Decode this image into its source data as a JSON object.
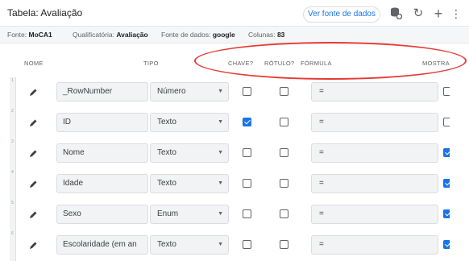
{
  "header": {
    "title": "Tabela: Avaliação",
    "view_source_label": "Ver fonte de dados",
    "icons": [
      "database-settings-icon",
      "refresh-icon",
      "add-icon",
      "more-vert-icon"
    ]
  },
  "info": {
    "source_label": "Fonte:",
    "source_value": "MoCA1",
    "qualifier_label": "Qualificatória:",
    "qualifier_value": "Avaliação",
    "datasource_label": "Fonte de dados:",
    "datasource_value": "google",
    "columns_label": "Colunas:",
    "columns_value": "83"
  },
  "columns": {
    "nome": "NOME",
    "tipo": "TIPO",
    "chave": "CHAVE?",
    "rotulo": "RÓTULO?",
    "formula": "FÓRMULA",
    "mostra": "MOSTRA"
  },
  "rows": [
    {
      "num": "1",
      "name": "_RowNumber",
      "type": "Número",
      "key": false,
      "label": false,
      "formula": "=",
      "show": false
    },
    {
      "num": "2",
      "name": "ID",
      "type": "Texto",
      "key": true,
      "label": false,
      "formula": "=",
      "show": false
    },
    {
      "num": "3",
      "name": "Nome",
      "type": "Texto",
      "key": false,
      "label": false,
      "formula": "=",
      "show": true
    },
    {
      "num": "4",
      "name": "Idade",
      "type": "Texto",
      "key": false,
      "label": false,
      "formula": "=",
      "show": true
    },
    {
      "num": "5",
      "name": "Sexo",
      "type": "Enum",
      "key": false,
      "label": false,
      "formula": "=",
      "show": true
    },
    {
      "num": "6",
      "name": "Escolaridade (em an",
      "type": "Texto",
      "key": false,
      "label": false,
      "formula": "=",
      "show": true
    }
  ],
  "colors": {
    "accent": "#1a73e8",
    "annotation": "#e53935"
  }
}
